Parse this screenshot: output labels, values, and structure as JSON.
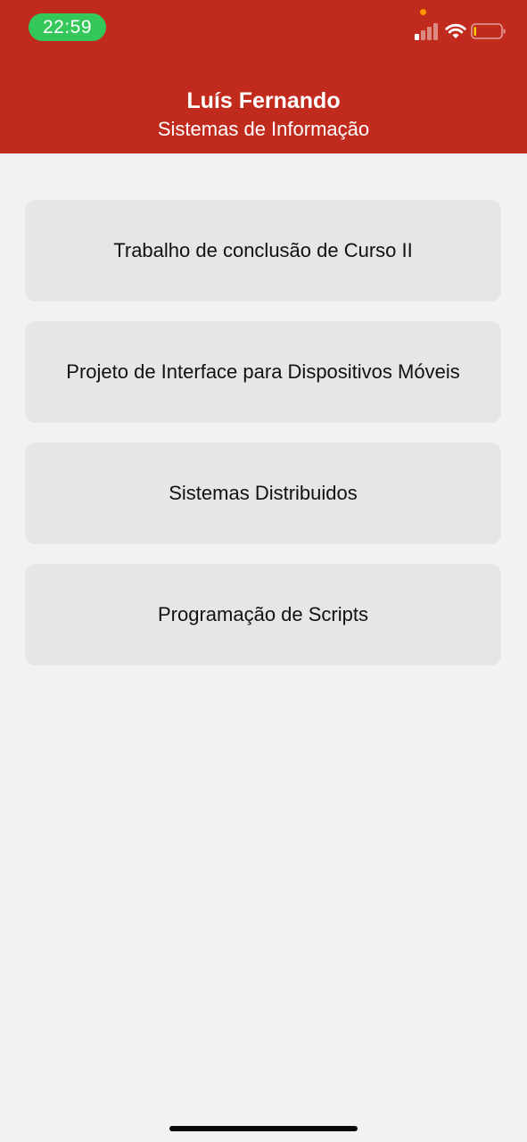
{
  "status_bar": {
    "time": "22:59",
    "time_pill_color": "#34c759",
    "privacy_dot_color": "#ff9500",
    "icons": [
      "cellular-signal-icon",
      "wifi-icon",
      "battery-icon"
    ]
  },
  "header": {
    "background_color": "#c12b1d",
    "user_name": "Luís Fernando",
    "course": "Sistemas de Informação"
  },
  "subjects": [
    {
      "label": "Trabalho de conclusão de Curso II"
    },
    {
      "label": "Projeto de Interface para Dispositivos Móveis"
    },
    {
      "label": "Sistemas Distribuidos"
    },
    {
      "label": "Programação de Scripts"
    }
  ]
}
